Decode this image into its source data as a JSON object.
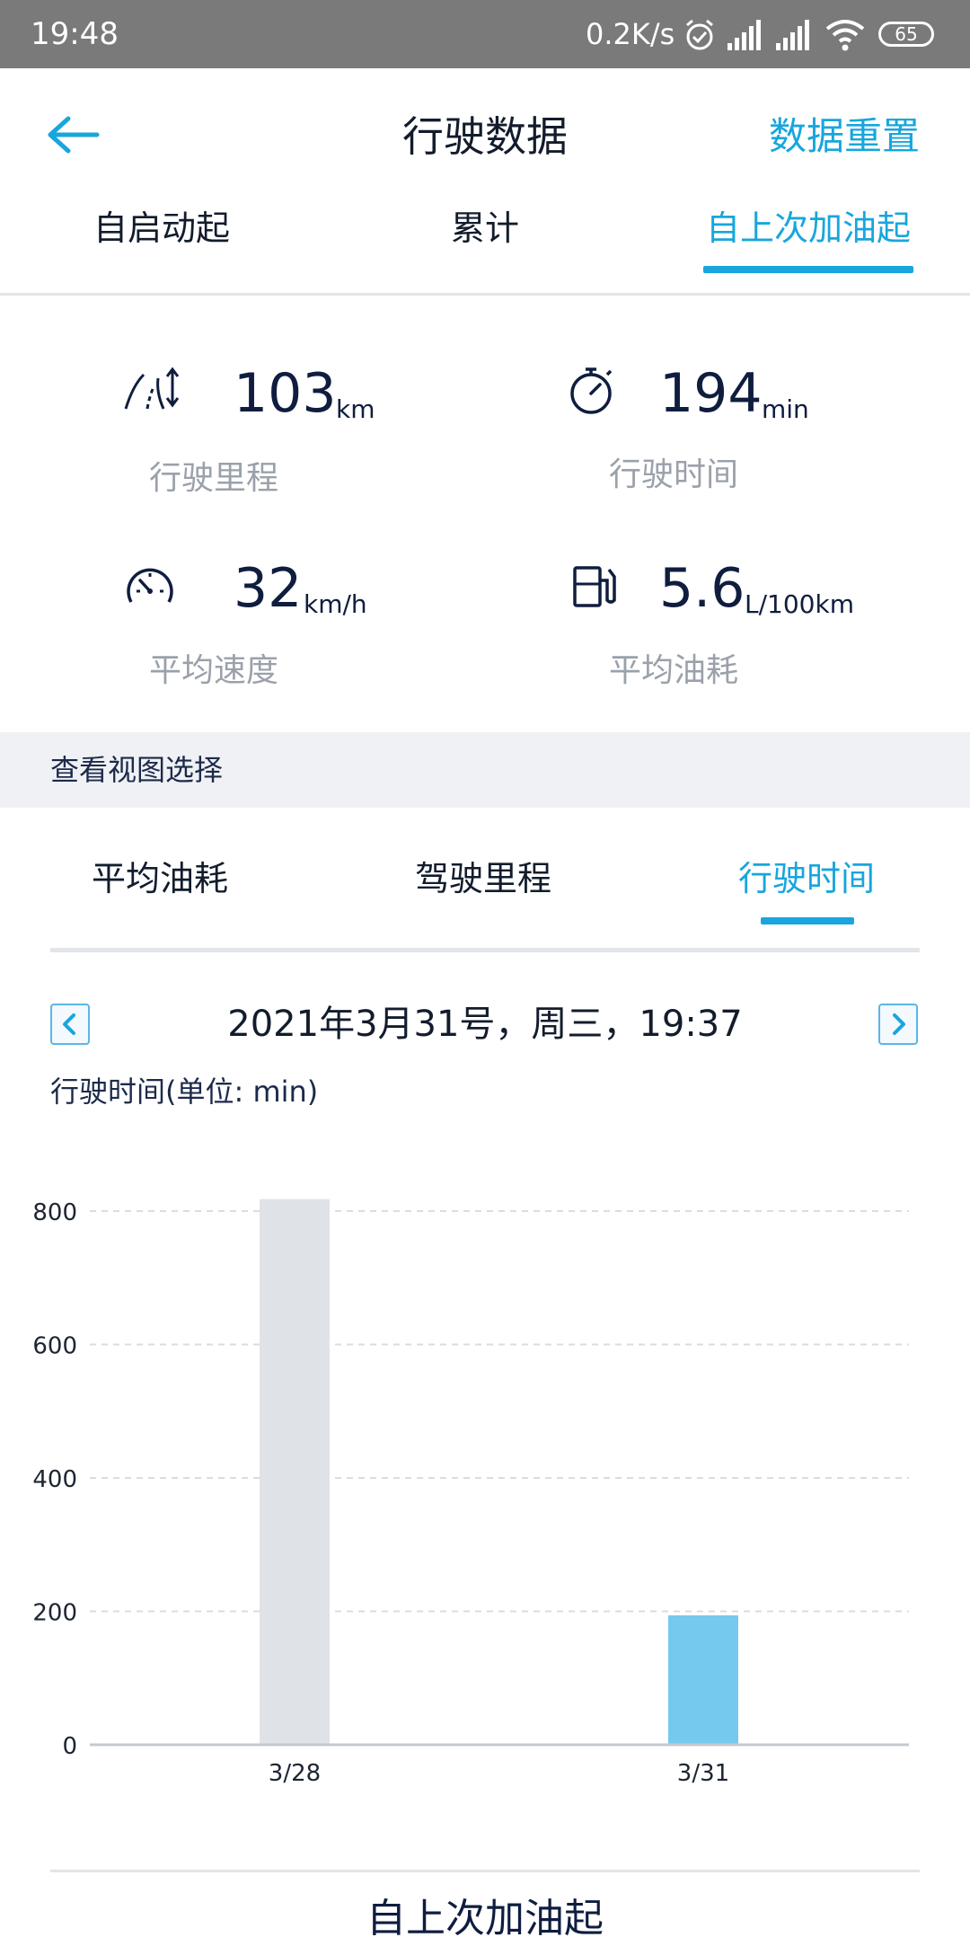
{
  "status_bar": {
    "time": "19:48",
    "net_speed": "0.2K/s",
    "battery": "65",
    "icons": [
      "alarm-icon",
      "signal-icon",
      "signal-icon",
      "wifi-icon",
      "battery-icon"
    ]
  },
  "header": {
    "title": "行驶数据",
    "reset_label": "数据重置",
    "tabs": [
      "自启动起",
      "累计",
      "自上次加油起"
    ],
    "active_tab": 2
  },
  "stats": [
    {
      "icon": "road-distance-icon",
      "value": "103",
      "unit": "km",
      "label": "行驶里程"
    },
    {
      "icon": "stopwatch-icon",
      "value": "194",
      "unit": "min",
      "label": "行驶时间"
    },
    {
      "icon": "speedometer-icon",
      "value": "32",
      "unit": "km/h",
      "label": "平均速度"
    },
    {
      "icon": "fuel-pump-icon",
      "value": "5.6",
      "unit": "L/100km",
      "label": "平均油耗"
    }
  ],
  "view_section": {
    "title": "查看视图选择",
    "tabs": [
      "平均油耗",
      "驾驶里程",
      "行驶时间"
    ],
    "active_tab": 2
  },
  "chart_nav": {
    "date": "2021年3月31号，周三，19:37",
    "unit_label": "行驶时间(单位: min)"
  },
  "chart_data": {
    "type": "bar",
    "categories": [
      "3/28",
      "3/31"
    ],
    "values": [
      818,
      194
    ],
    "highlight_index": 1,
    "ylim": [
      0,
      800
    ],
    "yticks": [
      0,
      200,
      400,
      600,
      800
    ],
    "grid": true,
    "colors": {
      "bar": "#dfe3e8",
      "highlight": "#76c9ee"
    }
  },
  "footer": {
    "label": "自上次加油起"
  },
  "colors": {
    "accent": "#18a6dc",
    "dark_text": "#0f1d3f",
    "muted_text": "#9aa1aa",
    "status_bar": "#7a7a7a"
  }
}
